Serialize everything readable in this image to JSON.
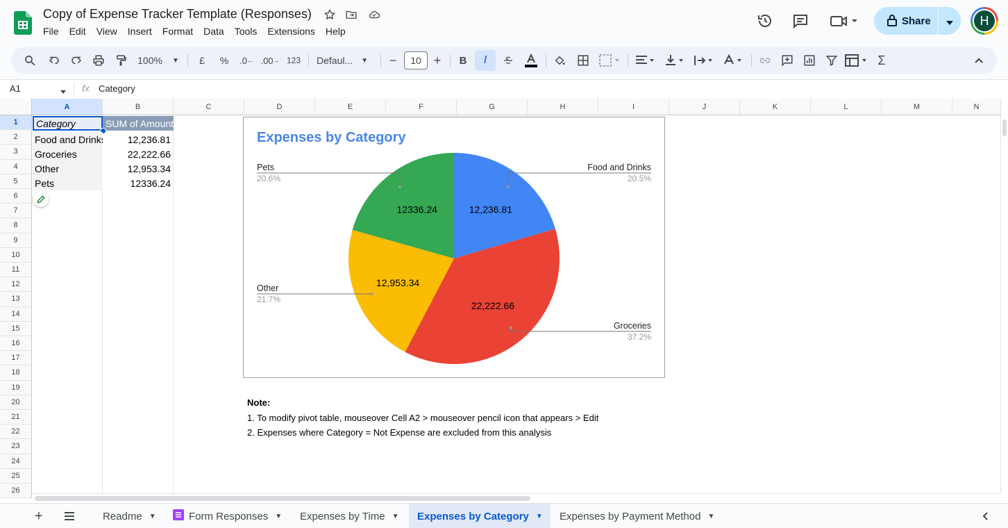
{
  "app": {
    "title": "Copy of Expense Tracker Template (Responses)"
  },
  "menu": [
    "File",
    "Edit",
    "View",
    "Insert",
    "Format",
    "Data",
    "Tools",
    "Extensions",
    "Help"
  ],
  "header": {
    "share_label": "Share",
    "avatar_letter": "H"
  },
  "toolbar": {
    "zoom": "100%",
    "currency": "£",
    "percent": "%",
    "dec_less": ".0",
    "dec_more": ".00",
    "number_format": "123",
    "font": "Defaul...",
    "font_size": "10",
    "bold": "B",
    "italic": "I",
    "minus": "−",
    "plus": "+",
    "sigma": "Σ"
  },
  "formula_bar": {
    "cell_ref": "A1",
    "fx": "fx",
    "value": "Category"
  },
  "columns": [
    "A",
    "B",
    "C",
    "D",
    "E",
    "F",
    "G",
    "H",
    "I",
    "J",
    "K",
    "L",
    "M",
    "N"
  ],
  "rows": [
    "1",
    "2",
    "3",
    "4",
    "5",
    "6",
    "7",
    "8",
    "9",
    "10",
    "11",
    "12",
    "13",
    "14",
    "15",
    "16",
    "17",
    "18",
    "19",
    "20",
    "21",
    "22",
    "23",
    "24",
    "25",
    "26"
  ],
  "pivot": {
    "header": [
      "Category",
      "SUM of Amount"
    ],
    "rows": [
      [
        "Food and Drinks",
        "12,236.81"
      ],
      [
        "Groceries",
        "22,222.66"
      ],
      [
        "Other",
        "12,953.34"
      ],
      [
        "Pets",
        "12336.24"
      ]
    ]
  },
  "note": {
    "title": "Note:",
    "lines": [
      "1. To modify pivot table, mouseover Cell A2 > mouseover pencil icon that appears > Edit",
      "2. Expenses where Category = Not Expense are excluded from this analysis"
    ]
  },
  "chart_data": {
    "type": "pie",
    "title": "Expenses by Category",
    "slices": [
      {
        "label": "Food and Drinks",
        "value": 12236.81,
        "value_label": "12,236.81",
        "percent": "20.5%",
        "color": "#4285f4"
      },
      {
        "label": "Groceries",
        "value": 22222.66,
        "value_label": "22,222.66",
        "percent": "37.2%",
        "color": "#ea4335"
      },
      {
        "label": "Other",
        "value": 12953.34,
        "value_label": "12,953.34",
        "percent": "21.7%",
        "color": "#fbbc04"
      },
      {
        "label": "Pets",
        "value": 12336.24,
        "value_label": "12336.24",
        "percent": "20.6%",
        "color": "#34a853"
      }
    ]
  },
  "sheet_tabs": [
    {
      "label": "Readme",
      "active": false
    },
    {
      "label": "Form Responses",
      "active": false
    },
    {
      "label": "Expenses by Time",
      "active": false
    },
    {
      "label": "Expenses by Category",
      "active": true
    },
    {
      "label": "Expenses by Payment Method",
      "active": false
    }
  ],
  "colors": {
    "accent": "#0b57d0",
    "chart_title": "#4a86e8",
    "pivot_header_bg": "#8a9cb5",
    "share_bg": "#c2e7ff"
  }
}
